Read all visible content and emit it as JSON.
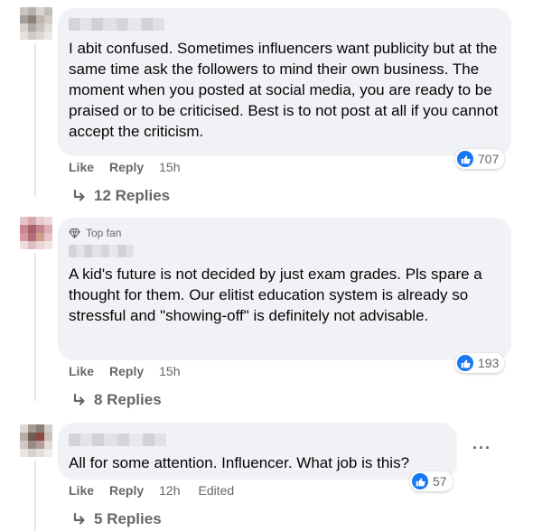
{
  "comments": [
    {
      "top_fan_label": "",
      "text": "I abit confused. Sometimes influencers want publicity but at the same time ask the followers to mind their own business. The moment when you posted at social media, you are ready to be praised or to be criticised. Best is to not post at all if you cannot accept the criticism.",
      "like_label": "Like",
      "reply_label": "Reply",
      "time": "15h",
      "edited": "",
      "reaction_count": "707",
      "replies_label": "12 Replies"
    },
    {
      "top_fan_label": "Top fan",
      "text": "A kid's future is not decided by just exam grades. Pls spare a thought for them. Our elitist education system is already so stressful and \"showing-off\" is definitely not advisable.",
      "like_label": "Like",
      "reply_label": "Reply",
      "time": "15h",
      "edited": "",
      "reaction_count": "193",
      "replies_label": "8 Replies"
    },
    {
      "top_fan_label": "",
      "text": "All for some attention. Influencer. What job is this?",
      "like_label": "Like",
      "reply_label": "Reply",
      "time": "12h",
      "edited": "Edited",
      "reaction_count": "57",
      "replies_label": "5 Replies",
      "more_label": "···"
    }
  ],
  "colors": {
    "bubble": "#f0f2f5",
    "like_blue": "#1877f2",
    "meta_text": "#65676b",
    "body_text": "#050505"
  },
  "icons": {
    "like": "thumbs-up-icon",
    "reply_arrow": "reply-arrow-icon",
    "top_fan": "diamond-icon",
    "more": "more-horizontal-icon"
  }
}
